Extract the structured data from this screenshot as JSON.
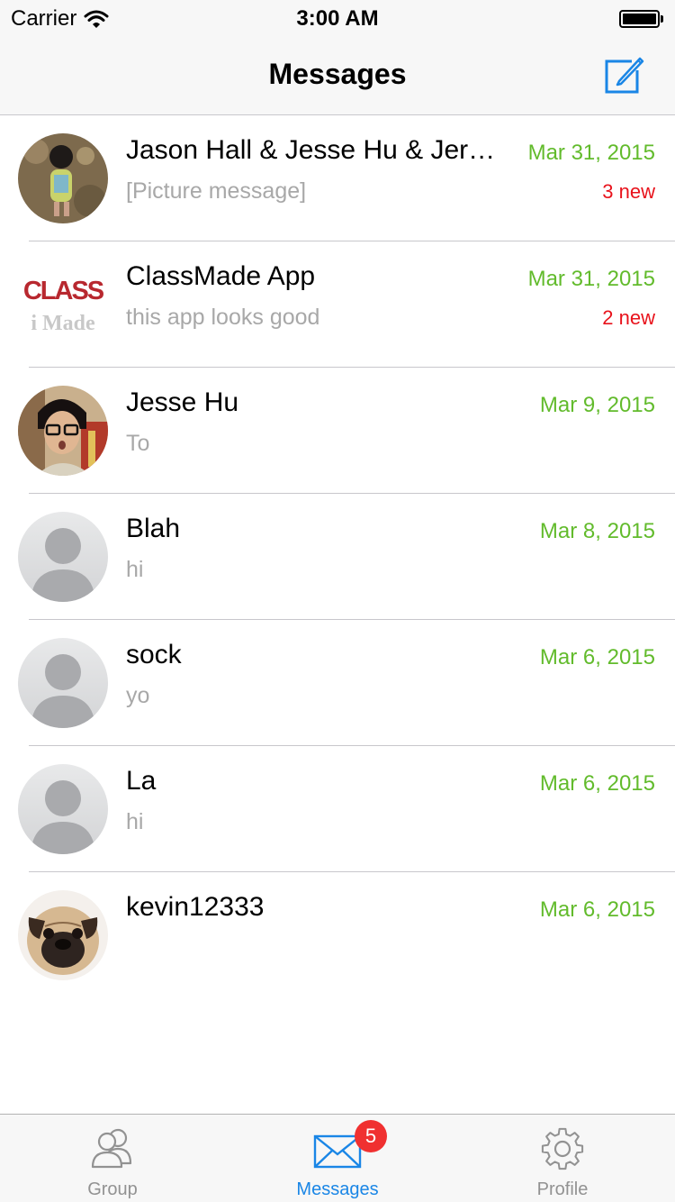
{
  "status_bar": {
    "carrier": "Carrier",
    "time": "3:00 AM"
  },
  "nav": {
    "title": "Messages",
    "compose_icon": "compose-icon"
  },
  "conversations": [
    {
      "name": "Jason Hall & Jesse Hu & Jeremy",
      "preview": "[Picture message]",
      "date": "Mar 31, 2015",
      "new_count": "3 new",
      "avatar": "photo-child"
    },
    {
      "name": "ClassMade App",
      "preview": "this app looks good",
      "date": "Mar 31, 2015",
      "new_count": "2 new",
      "avatar": "classmade-logo",
      "logo_top": "CLASS",
      "logo_bottom": "i Made"
    },
    {
      "name": "Jesse Hu",
      "preview": "To",
      "date": "Mar 9, 2015",
      "new_count": "",
      "avatar": "photo-person"
    },
    {
      "name": "Blah",
      "preview": "hi",
      "date": "Mar 8, 2015",
      "new_count": "",
      "avatar": "default-avatar"
    },
    {
      "name": "sock",
      "preview": "yo",
      "date": "Mar 6, 2015",
      "new_count": "",
      "avatar": "default-avatar"
    },
    {
      "name": "La",
      "preview": "hi",
      "date": "Mar 6, 2015",
      "new_count": "",
      "avatar": "default-avatar"
    },
    {
      "name": "kevin12333",
      "preview": "",
      "date": "Mar 6, 2015",
      "new_count": "",
      "avatar": "photo-pug"
    }
  ],
  "tabs": [
    {
      "label": "Group",
      "icon": "group-icon",
      "active": false
    },
    {
      "label": "Messages",
      "icon": "envelope-icon",
      "active": true,
      "badge": "5"
    },
    {
      "label": "Profile",
      "icon": "gear-icon",
      "active": false
    }
  ],
  "colors": {
    "accent": "#1a86e6",
    "date_green": "#62bb2c",
    "new_red": "#e8121b",
    "badge_red": "#f03030"
  }
}
